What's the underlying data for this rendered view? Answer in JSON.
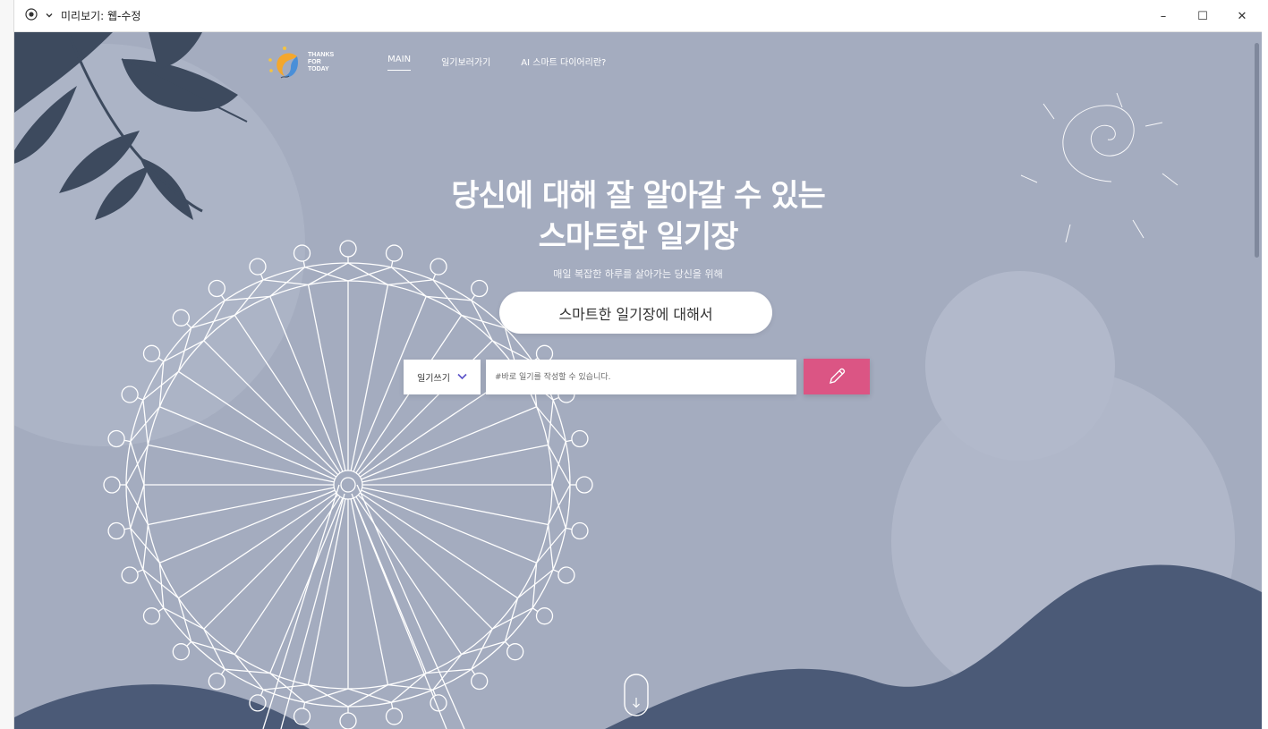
{
  "window": {
    "title": "미리보기: 웹-수정",
    "minimize_glyph": "–",
    "maximize_glyph": "☐",
    "close_glyph": "✕"
  },
  "nav": {
    "logo_lines": [
      "THANKS",
      "FOR",
      "TODAY"
    ],
    "links": [
      "MAIN",
      "일기보러가기",
      "AI 스마트 다이어리란?"
    ],
    "active_index": 0
  },
  "hero": {
    "title_line1": "당신에 대해 잘 알아갈 수 있는",
    "title_line2": "스마트한 일기장",
    "subtitle": "매일 복잡한 하루를 살아가는 당신을 위해",
    "about_button": "스마트한 일기장에 대해서"
  },
  "diary_form": {
    "select_value": "일기쓰기",
    "input_placeholder": "#바로 일기를 작성할 수 있습니다.",
    "input_value": ""
  },
  "colors": {
    "background": "#a4acbf",
    "hill": "#4b5a77",
    "leaf": "#3d4a5e",
    "write_button": "#db5584",
    "select_chevron": "#5a52c8"
  },
  "icons": {
    "window_app": "radio-icon",
    "window_menu": "chevron-down-icon",
    "write": "pencil-icon",
    "scroll": "scroll-down-icon"
  }
}
